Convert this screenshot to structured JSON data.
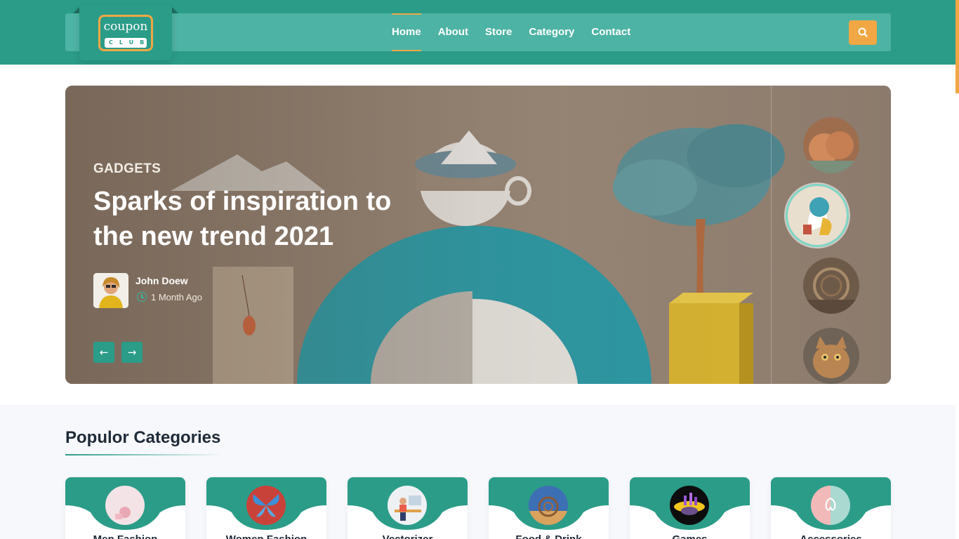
{
  "brand": {
    "logo_top": "coupon",
    "logo_bottom": "CLUB"
  },
  "nav": {
    "items": [
      {
        "label": "Home",
        "active": true
      },
      {
        "label": "About",
        "active": false
      },
      {
        "label": "Store",
        "active": false
      },
      {
        "label": "Category",
        "active": false
      },
      {
        "label": "Contact",
        "active": false
      }
    ],
    "search_icon": "search-icon"
  },
  "hero": {
    "category": "GADGETS",
    "title": "Sparks of inspiration to the new trend 2021",
    "author": "John Doew",
    "time": "1 Month Ago",
    "prev_icon": "arrow-left-icon",
    "next_icon": "arrow-right-icon"
  },
  "categories": {
    "title": "Populor Categories",
    "items": [
      {
        "label": "Men Fashion"
      },
      {
        "label": "Women Fashion"
      },
      {
        "label": "Vectorizer"
      },
      {
        "label": "Food & Drink"
      },
      {
        "label": "Games"
      },
      {
        "label": "Accessories"
      }
    ]
  },
  "colors": {
    "primary": "#2b9c88",
    "accent": "#f0a744",
    "nav_bar": "#4db3a4"
  }
}
